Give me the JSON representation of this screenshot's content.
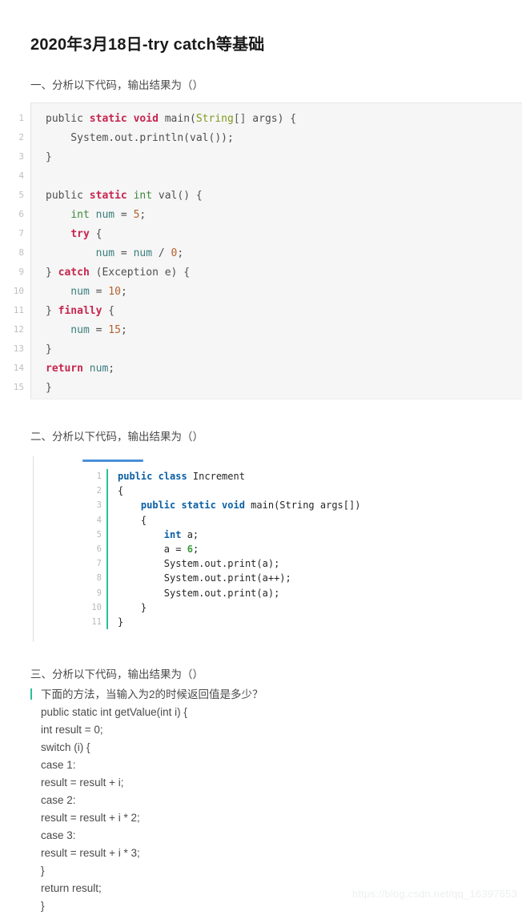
{
  "post": {
    "title": "2020年3月18日-try catch等基础",
    "watermark": "https://blog.csdn.net/qq_16397653"
  },
  "sections": [
    {
      "heading": "一、分析以下代码，输出结果为（）"
    },
    {
      "heading": "二、分析以下代码，输出结果为（）"
    },
    {
      "heading": "三、分析以下代码，输出结果为（）"
    }
  ],
  "colors": {
    "tab_bar_blue": "#4a90d9",
    "code2_separator_green": "#2bbf9b",
    "section3_mark_green": "#2bbf9b",
    "code1_background": "#f6f6f6",
    "title_text": "#1a1a1a",
    "body_text": "#4a4a4a",
    "watermark_text": "#eceff1"
  },
  "code_block_1": {
    "language": "java",
    "line_numbers": [
      "1",
      "2",
      "3",
      "4",
      "5",
      "6",
      "7",
      "8",
      "9",
      "10",
      "11",
      "12",
      "13",
      "14",
      "15"
    ],
    "lines": [
      "public static void main(String[] args) {",
      "    System.out.println(val());",
      "}",
      "",
      "public static int val() {",
      "    int num = 5;",
      "    try {",
      "        num = num / 0;",
      "} catch (Exception e) {",
      "    num = 10;",
      "} finally {",
      "    num = 15;",
      "}",
      "return num;",
      "}"
    ]
  },
  "code_block_2": {
    "language": "java",
    "line_numbers": [
      "1",
      "2",
      "3",
      "4",
      "5",
      "6",
      "7",
      "8",
      "9",
      "10",
      "11"
    ],
    "lines": [
      "public class Increment",
      "{",
      "    public static void main(String args[])",
      "    {",
      "        int a;",
      "        a = 6;",
      "        System.out.print(a);",
      "        System.out.print(a++);",
      "        System.out.print(a);",
      "    }",
      "}"
    ]
  },
  "section_3_text": {
    "lines": [
      "下面的方法，当输入为2的时候返回值是多少？",
      "public static int getValue(int i) {",
      "int result = 0;",
      "switch (i) {",
      "case 1:",
      "result = result + i;",
      "case 2:",
      "result = result + i * 2;",
      "case 3:",
      "result = result + i * 3;",
      "}",
      "return result;",
      "}"
    ]
  }
}
